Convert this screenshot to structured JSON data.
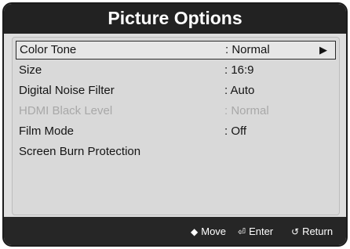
{
  "screen": {
    "title": "Picture Options"
  },
  "menu": {
    "items": [
      {
        "label": "Color Tone",
        "value": ": Normal",
        "arrow": "▶"
      },
      {
        "label": "Size",
        "value": ": 16:9"
      },
      {
        "label": "Digital Noise Filter",
        "value": ": Auto"
      },
      {
        "label": "HDMI Black Level",
        "value": ": Normal"
      },
      {
        "label": "Film Mode",
        "value": ": Off"
      },
      {
        "label": "Screen Burn Protection",
        "value": ""
      }
    ]
  },
  "footer": {
    "move": {
      "icon": "◆",
      "label": "Move"
    },
    "enter": {
      "icon": "⏎",
      "label": "Enter"
    },
    "return": {
      "icon": "↺",
      "label": "Return"
    }
  }
}
